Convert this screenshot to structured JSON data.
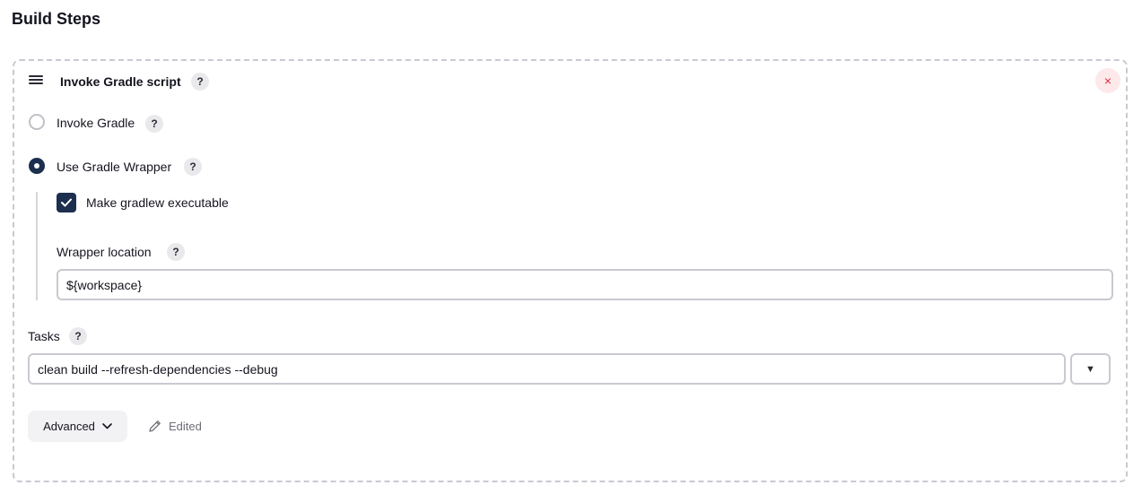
{
  "section": {
    "title": "Build Steps"
  },
  "step": {
    "title": "Invoke Gradle script",
    "help": "?",
    "close": "×"
  },
  "options": {
    "invoke_gradle": {
      "label": "Invoke Gradle",
      "help": "?",
      "selected": false
    },
    "use_wrapper": {
      "label": "Use Gradle Wrapper",
      "help": "?",
      "selected": true
    }
  },
  "wrapper": {
    "make_executable_label": "Make gradlew executable",
    "make_executable_checked": true,
    "location_label": "Wrapper location",
    "location_help": "?",
    "location_value": "${workspace}"
  },
  "tasks": {
    "label": "Tasks",
    "help": "?",
    "value": "clean build --refresh-dependencies --debug",
    "dropdown_glyph": "▼"
  },
  "footer": {
    "advanced_label": "Advanced",
    "edited_label": "Edited"
  },
  "colors": {
    "accent": "#1c2f4f",
    "danger": "#e0283c",
    "border": "#c9c9d1"
  }
}
